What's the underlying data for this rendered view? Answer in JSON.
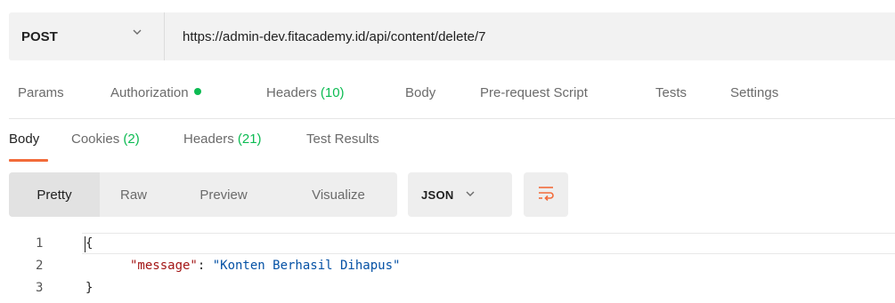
{
  "request": {
    "method": "POST",
    "url": "https://admin-dev.fitacademy.id/api/content/delete/7"
  },
  "request_tabs": {
    "params": "Params",
    "authorization": "Authorization",
    "headers": "Headers",
    "headers_count": "(10)",
    "body": "Body",
    "pre_request": "Pre-request Script",
    "tests": "Tests",
    "settings": "Settings"
  },
  "response_tabs": {
    "body": "Body",
    "cookies": "Cookies",
    "cookies_count": "(2)",
    "headers": "Headers",
    "headers_count": "(21)",
    "test_results": "Test Results"
  },
  "body_views": {
    "pretty": "Pretty",
    "raw": "Raw",
    "preview": "Preview",
    "visualize": "Visualize",
    "format": "JSON"
  },
  "code": {
    "line_numbers": [
      "1",
      "2",
      "3"
    ],
    "open_brace": "{",
    "close_brace": "}",
    "key": "\"message\"",
    "colon": ": ",
    "value": "\"Konten Berhasil Dihapus\""
  },
  "colors": {
    "accent": "#f26b3a",
    "status_green": "#0cbb52"
  }
}
